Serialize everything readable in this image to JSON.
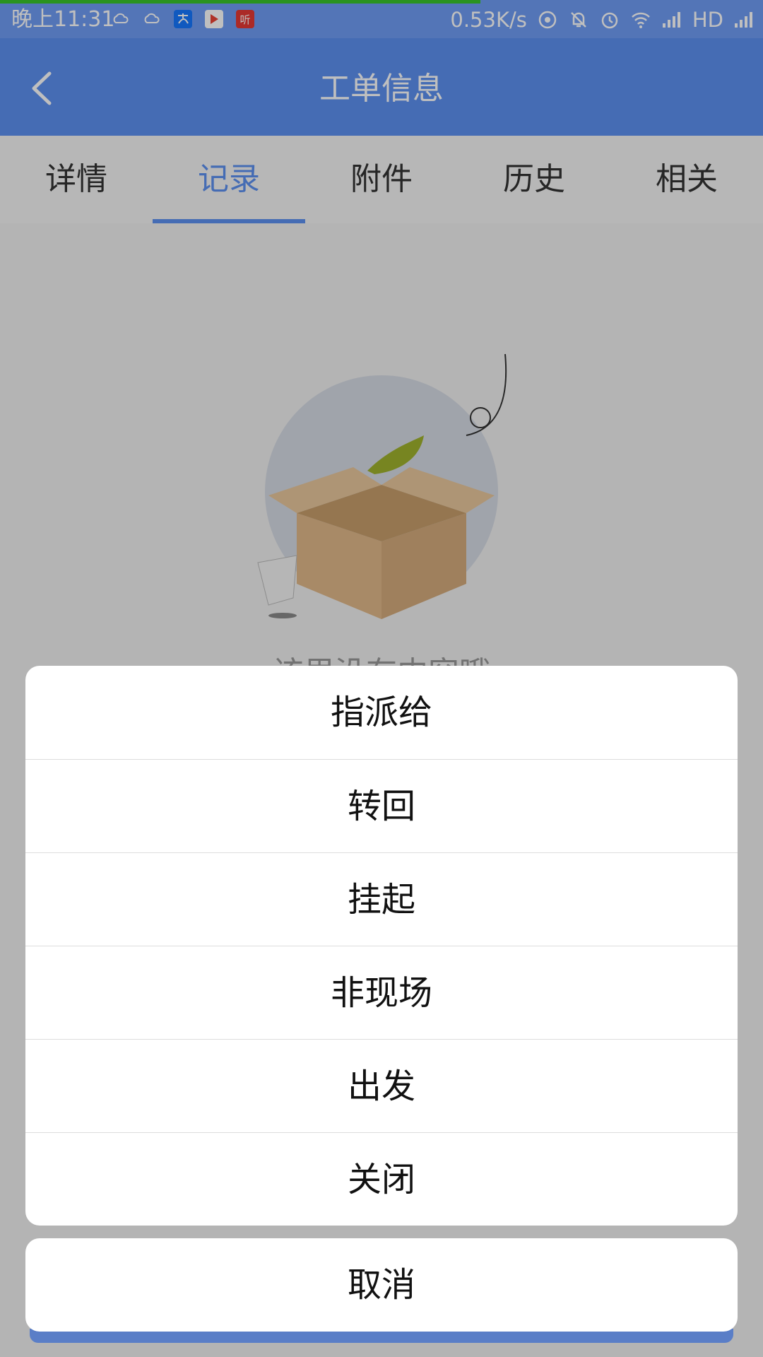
{
  "status_bar": {
    "time": "晚上11:31",
    "net_speed": "0.53K/s",
    "network": "HD",
    "app_badge": "听"
  },
  "nav": {
    "title": "工单信息"
  },
  "tabs": [
    {
      "label": "详情"
    },
    {
      "label": "记录",
      "active": true
    },
    {
      "label": "附件"
    },
    {
      "label": "历史"
    },
    {
      "label": "相关"
    }
  ],
  "content": {
    "empty_text": "该里没有内容哦"
  },
  "action_sheet": {
    "items": [
      {
        "label": "指派给"
      },
      {
        "label": "转回"
      },
      {
        "label": "挂起"
      },
      {
        "label": "非现场"
      },
      {
        "label": "出发"
      },
      {
        "label": "关闭"
      }
    ],
    "cancel_label": "取消"
  },
  "colors": {
    "status_bar": "#6f9cf4",
    "primary": "#5d90f0",
    "progress": "#39c42a",
    "overlay": "rgba(0,0,0,0.25)"
  }
}
